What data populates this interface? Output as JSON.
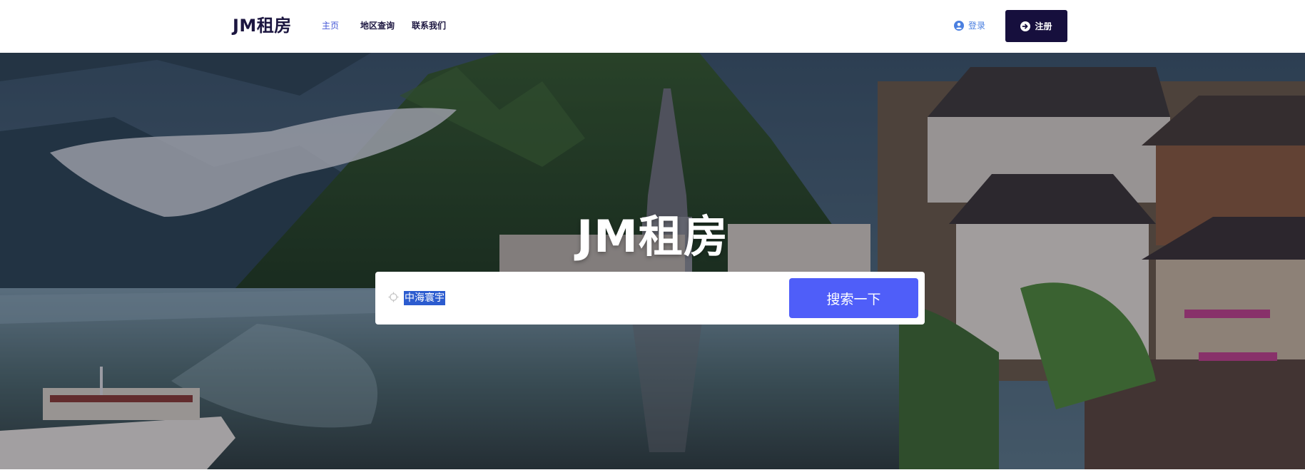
{
  "header": {
    "brand": "JM租房",
    "nav": [
      {
        "label": "主页",
        "active": true
      },
      {
        "label": "地区查询",
        "active": false
      },
      {
        "label": "联系我们",
        "active": false
      }
    ],
    "login_label": "登录",
    "register_label": "注册"
  },
  "hero": {
    "title": "JM租房",
    "search": {
      "value": "中海寰宇",
      "button_label": "搜索一下"
    }
  },
  "colors": {
    "brand_dark": "#160f3d",
    "accent_blue": "#4f5ef9",
    "link_blue": "#4a7fe0"
  },
  "icons": {
    "login": "user-circle-icon",
    "register": "arrow-right-circle-icon",
    "search_prefix": "crosshair-icon"
  }
}
